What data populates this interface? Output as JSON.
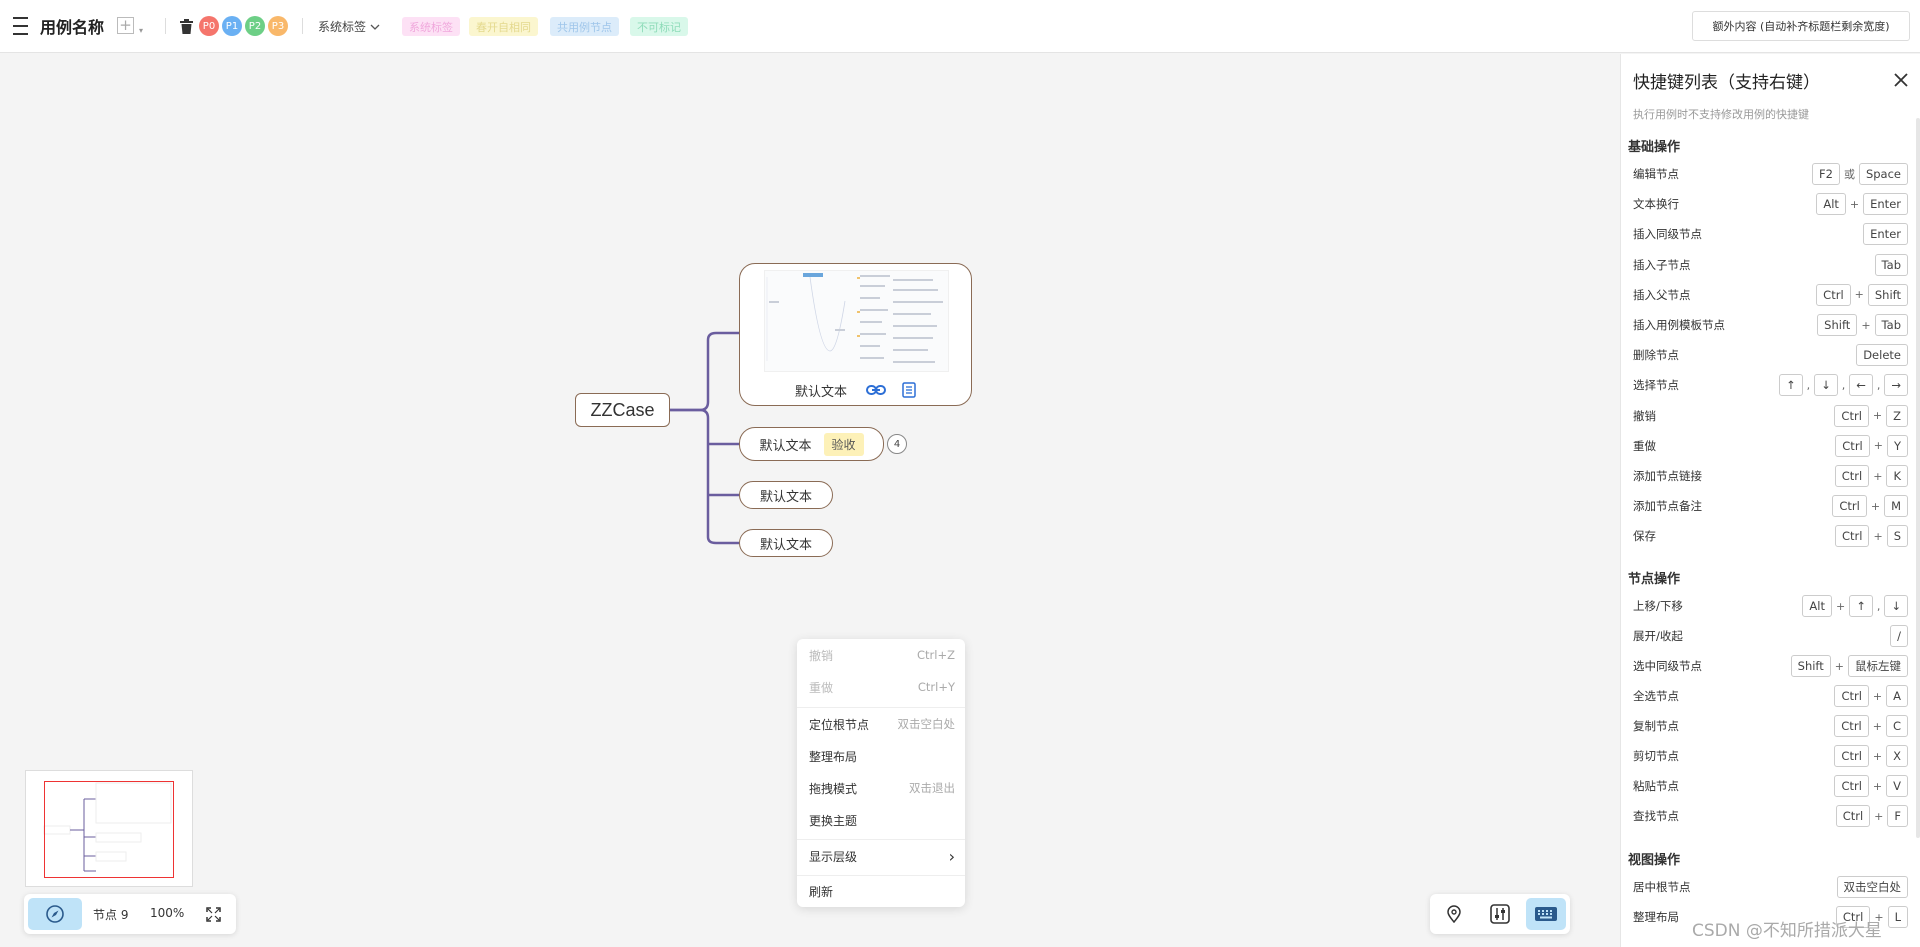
{
  "topbar": {
    "title": "用例名称",
    "add_symbol": "+",
    "caret_symbol": "▾",
    "priorities": [
      {
        "label": "P0",
        "color": "#f5756c"
      },
      {
        "label": "P1",
        "color": "#6ab0f3"
      },
      {
        "label": "P2",
        "color": "#6dcf86"
      },
      {
        "label": "P3",
        "color": "#f9b86a"
      }
    ],
    "system_tag_label": "系统标签",
    "chips": [
      {
        "label": "系统标签",
        "bg": "#fde1f5",
        "fg": "#f0a8dc"
      },
      {
        "label": "春开自相同",
        "bg": "#fbf6cf",
        "fg": "#e4d98e"
      },
      {
        "label": "共用例节点",
        "bg": "#dcecfa",
        "fg": "#9fc6ea"
      },
      {
        "label": "不可标记",
        "bg": "#d9f8ea",
        "fg": "#8fdcb9"
      }
    ],
    "extra_button": "额外内容 (自动补齐标题栏剩余宽度)"
  },
  "mindmap": {
    "root": "ZZCase",
    "big_node_text": "默认文本",
    "node2_text": "默认文本",
    "node2_tag": "验收",
    "node2_count": "4",
    "node3_text": "默认文本",
    "node4_text": "默认文本"
  },
  "context_menu": {
    "undo": {
      "label": "撤销",
      "shortcut": "Ctrl+Z"
    },
    "redo": {
      "label": "重做",
      "shortcut": "Ctrl+Y"
    },
    "locate_root": {
      "label": "定位根节点",
      "shortcut": "双击空白处"
    },
    "arrange": {
      "label": "整理布局"
    },
    "drag_mode": {
      "label": "拖拽模式",
      "shortcut": "双击退出"
    },
    "theme": {
      "label": "更换主题"
    },
    "levels": {
      "label": "显示层级",
      "arrow": "›"
    },
    "refresh": {
      "label": "刷新"
    }
  },
  "bottom_left": {
    "node_count": "节点 9",
    "zoom": "100%"
  },
  "shortcut_panel": {
    "title": "快捷键列表（支持右键）",
    "subtitle": "执行用例时不支持修改用例的快捷键",
    "basic_title": "基础操作",
    "node_title": "节点操作",
    "view_title": "视图操作",
    "basic": [
      {
        "label": "编辑节点",
        "keys": [
          "F2",
          "或",
          "Space"
        ]
      },
      {
        "label": "文本换行",
        "keys": [
          "Alt",
          "+",
          "Enter"
        ]
      },
      {
        "label": "插入同级节点",
        "keys": [
          "Enter"
        ]
      },
      {
        "label": "插入子节点",
        "keys": [
          "Tab"
        ]
      },
      {
        "label": "插入父节点",
        "keys": [
          "Ctrl",
          "+",
          "Shift"
        ]
      },
      {
        "label": "插入用例模板节点",
        "keys": [
          "Shift",
          "+",
          "Tab"
        ]
      },
      {
        "label": "删除节点",
        "keys": [
          "Delete"
        ]
      },
      {
        "label": "选择节点",
        "keys": [
          "↑",
          ",",
          "↓",
          ",",
          "←",
          ",",
          "→"
        ]
      },
      {
        "label": "撤销",
        "keys": [
          "Ctrl",
          "+",
          "Z"
        ]
      },
      {
        "label": "重做",
        "keys": [
          "Ctrl",
          "+",
          "Y"
        ]
      },
      {
        "label": "添加节点链接",
        "keys": [
          "Ctrl",
          "+",
          "K"
        ]
      },
      {
        "label": "添加节点备注",
        "keys": [
          "Ctrl",
          "+",
          "M"
        ]
      },
      {
        "label": "保存",
        "keys": [
          "Ctrl",
          "+",
          "S"
        ]
      }
    ],
    "node_ops": [
      {
        "label": "上移/下移",
        "keys": [
          "Alt",
          "+",
          "↑",
          ",",
          "↓"
        ]
      },
      {
        "label": "展开/收起",
        "keys": [
          "/"
        ]
      },
      {
        "label": "选中同级节点",
        "keys": [
          "Shift",
          "+",
          "鼠标左键"
        ]
      },
      {
        "label": "全选节点",
        "keys": [
          "Ctrl",
          "+",
          "A"
        ]
      },
      {
        "label": "复制节点",
        "keys": [
          "Ctrl",
          "+",
          "C"
        ]
      },
      {
        "label": "剪切节点",
        "keys": [
          "Ctrl",
          "+",
          "X"
        ]
      },
      {
        "label": "粘贴节点",
        "keys": [
          "Ctrl",
          "+",
          "V"
        ]
      },
      {
        "label": "查找节点",
        "keys": [
          "Ctrl",
          "+",
          "F"
        ]
      }
    ],
    "view_ops": [
      {
        "label": "居中根节点",
        "keys": [
          "双击空白处"
        ]
      },
      {
        "label": "整理布局",
        "keys": [
          "Ctrl",
          "+",
          "L"
        ]
      }
    ]
  },
  "watermark": "CSDN @不知所措派大星"
}
